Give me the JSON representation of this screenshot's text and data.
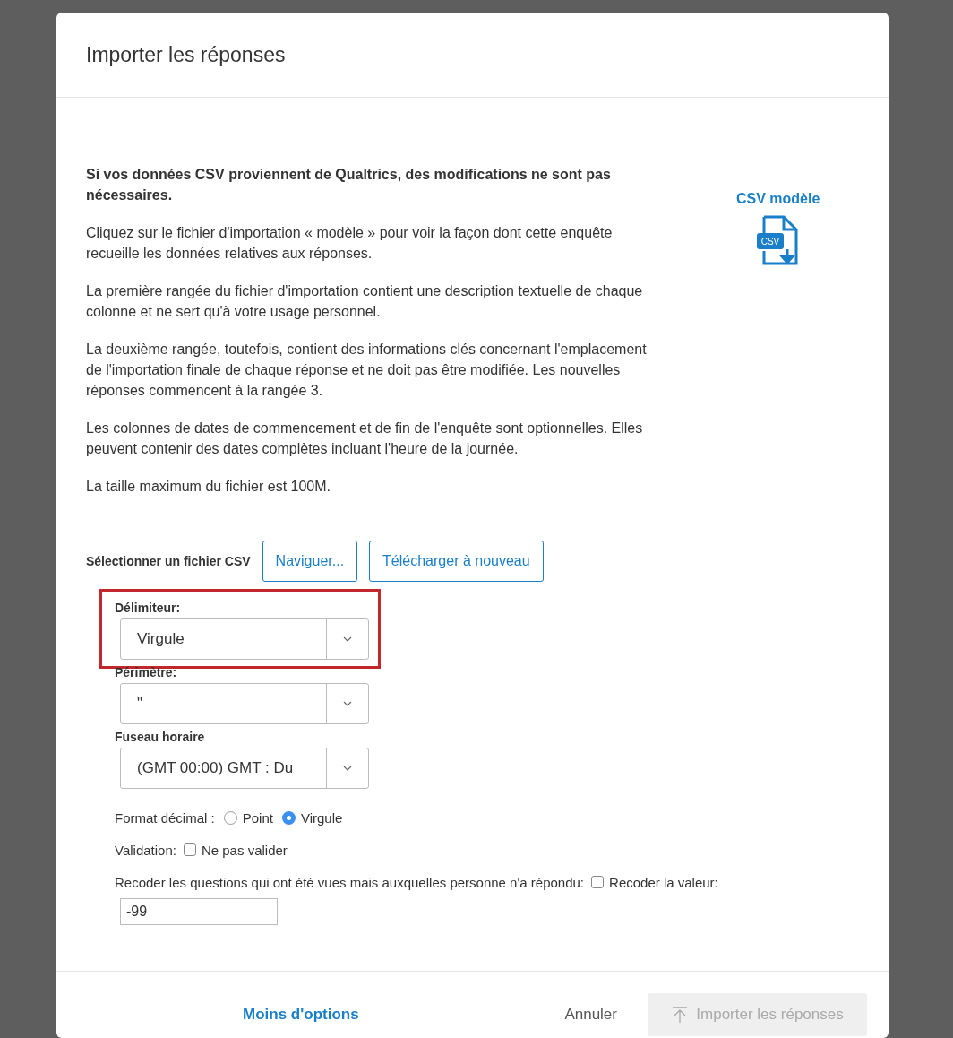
{
  "dialog": {
    "title": "Importer les réponses",
    "notice": "Si vos données CSV proviennent de Qualtrics, des modifications ne sont pas nécessaires.",
    "paragraphs": [
      "Cliquez sur le fichier d'importation « modèle » pour voir la façon dont cette enquête recueille les données relatives aux réponses.",
      "La première rangée du fichier d'importation contient une description textuelle de chaque colonne et ne sert qu'à votre usage personnel.",
      "La deuxième rangée, toutefois, contient des informations clés concernant l'emplacement de l'importation finale de chaque réponse et ne doit pas être modifiée. Les nouvelles réponses commencent à la rangée 3.",
      "Les colonnes de dates de commencement et de fin de l'enquête sont optionnelles. Elles peuvent contenir des dates complètes incluant l'heure de la journée.",
      "La taille maximum du fichier est 100M."
    ],
    "template_link": "CSV modèle",
    "template_icon_label": "CSV",
    "file_select": {
      "label": "Sélectionner un fichier CSV",
      "buttons": [
        "Naviguer...",
        "Télécharger à nouveau"
      ]
    },
    "dropdowns": [
      {
        "label": "Délimiteur:",
        "value": "Virgule",
        "highlighted": true
      },
      {
        "label": "Périmètre:",
        "value": "\"",
        "highlighted": false
      },
      {
        "label": "Fuseau horaire",
        "value": "(GMT 00:00) GMT : Du",
        "highlighted": false
      }
    ],
    "decimal_format": {
      "label": "Format décimal :",
      "options": [
        {
          "label": "Point",
          "selected": false
        },
        {
          "label": "Virgule",
          "selected": true
        }
      ]
    },
    "validation": {
      "label": "Validation:",
      "option": {
        "label": "Ne pas valider",
        "checked": false
      }
    },
    "recode": {
      "label": "Recoder les questions qui ont été vues mais auxquelles personne n'a répondu:",
      "option": {
        "label": "Recoder la valeur:",
        "checked": false
      },
      "value": "-99"
    },
    "footer": {
      "less_options": "Moins d'options",
      "cancel": "Annuler",
      "import": {
        "label": "Importer les réponses",
        "disabled": true
      }
    }
  }
}
